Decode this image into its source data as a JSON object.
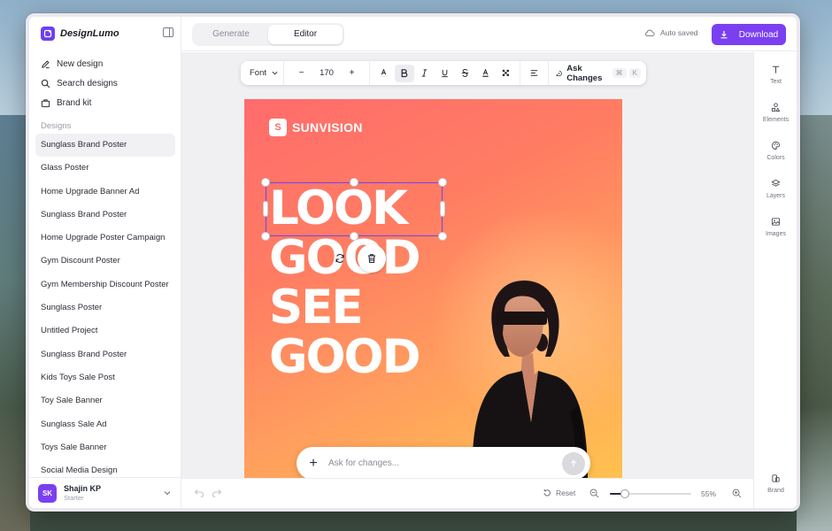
{
  "app": {
    "name": "DesignLumo"
  },
  "sidebar": {
    "nav": [
      {
        "label": "New design",
        "icon": "edit-icon"
      },
      {
        "label": "Search designs",
        "icon": "search-icon"
      },
      {
        "label": "Brand kit",
        "icon": "brand-kit-icon"
      }
    ],
    "section_label": "Designs",
    "designs": [
      "Sunglass Brand Poster",
      "Glass Poster",
      "Home Upgrade Banner Ad",
      "Sunglass Brand Poster",
      "Home Upgrade Poster Campaign",
      "Gym Discount Poster",
      "Gym Membership Discount Poster",
      "Sunglass Poster",
      "Untitled Project",
      "Sunglass Brand Poster",
      "Kids Toys Sale Post",
      "Toy Sale Banner",
      "Sunglass Sale Ad",
      "Toys Sale Banner",
      "Social Media Design"
    ],
    "user": {
      "initials": "SK",
      "name": "Shajin KP",
      "plan": "Starter"
    }
  },
  "topbar": {
    "tabs": [
      "Generate",
      "Editor"
    ],
    "active_tab": "Editor",
    "autosave": "Auto saved",
    "download_label": "Download"
  },
  "toolbar": {
    "font_label": "Font",
    "font_size": "170",
    "ask_label": "Ask Changes",
    "shortcut_cmd": "⌘",
    "shortcut_key": "K"
  },
  "poster": {
    "brand_letter": "S",
    "brand_name": "SUNVISION",
    "headline": [
      "LOOK",
      "GOOD",
      "SEE",
      "GOOD"
    ]
  },
  "prompt": {
    "placeholder": "Ask for changes..."
  },
  "bottombar": {
    "reset_label": "Reset",
    "zoom_label": "55%",
    "zoom_fraction": 0.18
  },
  "right_rail": [
    {
      "label": "Text",
      "icon": "text-icon"
    },
    {
      "label": "Elements",
      "icon": "elements-icon"
    },
    {
      "label": "Colors",
      "icon": "palette-icon"
    },
    {
      "label": "Layers",
      "icon": "layers-icon"
    },
    {
      "label": "Images",
      "icon": "image-icon"
    },
    {
      "label": "Brand",
      "icon": "brand-icon"
    }
  ],
  "colors": {
    "accent": "#7b3ff2",
    "poster_start": "#ff6c6c",
    "poster_end": "#ffc24f"
  }
}
